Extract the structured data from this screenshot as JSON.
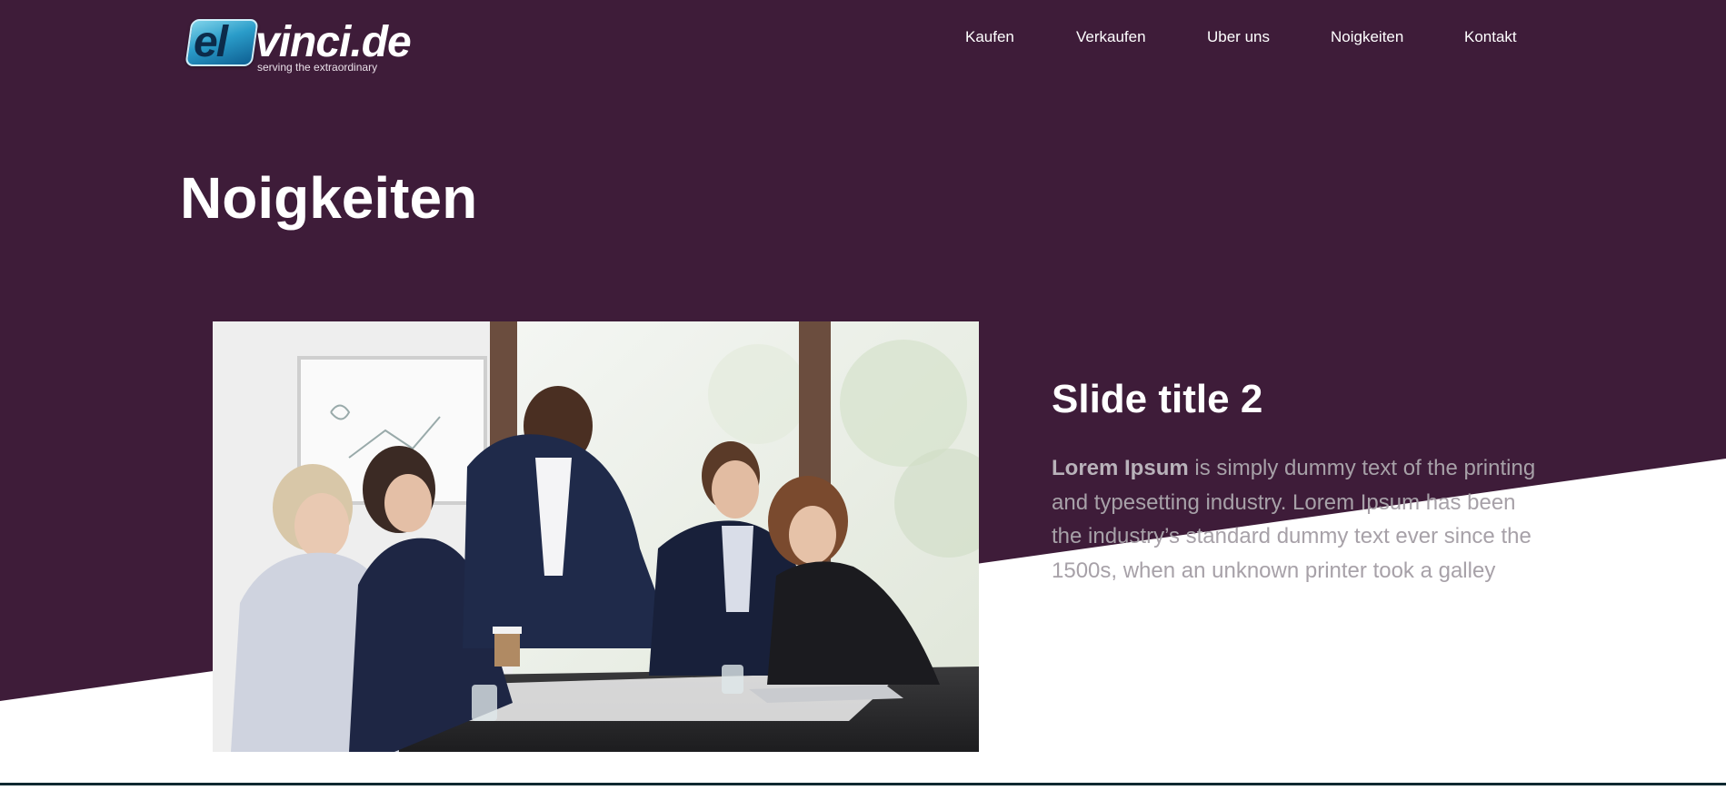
{
  "colors": {
    "brand_purple": "#3e1c39",
    "white": "#ffffff",
    "body_text_grey": "#a7a1a8",
    "logo_blue": "#2a9cc9"
  },
  "logo": {
    "prefix": "el",
    "name": "vinci.de",
    "tagline": "serving the extraordinary"
  },
  "nav": {
    "items": [
      {
        "label": "Kaufen"
      },
      {
        "label": "Verkaufen"
      },
      {
        "label": "Uber uns"
      },
      {
        "label": "Noigkeiten"
      },
      {
        "label": "Kontakt"
      }
    ]
  },
  "page": {
    "title": "Noigkeiten"
  },
  "slide": {
    "title": "Slide title 2",
    "text_bold": "Lorem Ipsum",
    "text_rest": " is simply dummy text of the printing and typesetting industry. Lorem Ipsum has been the industry’s standard dummy text ever since the 1500s, when an unknown printer took a galley",
    "image_icon": "business-meeting-photo"
  }
}
